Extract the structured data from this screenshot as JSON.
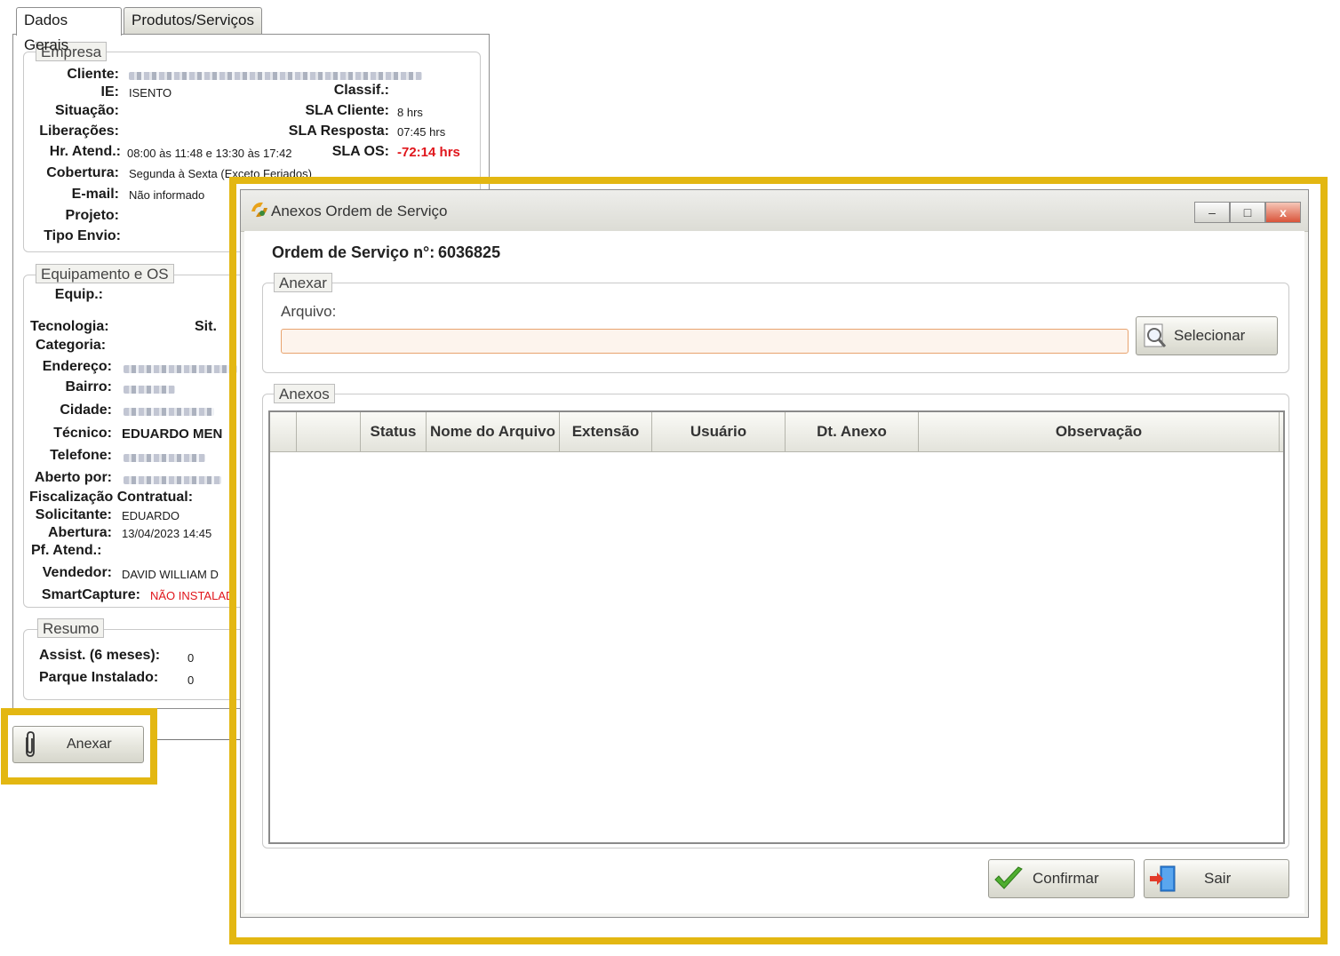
{
  "back_form": {
    "tabs": [
      "Dados Gerais",
      "Produtos/Serviços"
    ],
    "empresa": {
      "title": "Empresa",
      "cliente_label": "Cliente:",
      "ie_label": "IE:",
      "ie_value": "ISENTO",
      "classif_label": "Classif.:",
      "situacao_label": "Situação:",
      "sla_cliente_label": "SLA Cliente:",
      "sla_cliente_value": "8 hrs",
      "liberacoes_label": "Liberações:",
      "sla_resposta_label": "SLA Resposta:",
      "sla_resposta_value": "07:45 hrs",
      "hr_atend_label": "Hr. Atend.:",
      "hr_atend_value": "08:00 às 11:48 e 13:30 às 17:42",
      "sla_os_label": "SLA OS:",
      "sla_os_value": "-72:14 hrs",
      "cobertura_label": "Cobertura:",
      "cobertura_value": "Segunda à Sexta (Exceto Feriados)",
      "email_label": "E-mail:",
      "email_value": "Não informado",
      "projeto_label": "Projeto:",
      "tipo_envio_label": "Tipo Envio:"
    },
    "equipamento": {
      "title": "Equipamento e OS",
      "equip_label": "Equip.:",
      "tecnologia_label": "Tecnologia:",
      "sit_label": "Sit.",
      "categoria_label": "Categoria:",
      "endereco_label": "Endereço:",
      "bairro_label": "Bairro:",
      "cidade_label": "Cidade:",
      "tecnico_label": "Técnico:",
      "tecnico_value": "EDUARDO MEN",
      "telefone_label": "Telefone:",
      "aberto_por_label": "Aberto por:",
      "fiscalizacao_label": "Fiscalização Contratual:",
      "solicitante_label": "Solicitante:",
      "solicitante_value": "EDUARDO",
      "abertura_label": "Abertura:",
      "abertura_value": "13/04/2023 14:45",
      "pf_atend_label": "Pf. Atend.:",
      "vendedor_label": "Vendedor:",
      "vendedor_value": "DAVID WILLIAM D",
      "smartcapture_label": "SmartCapture:",
      "smartcapture_value": "NÃO INSTALAD"
    },
    "resumo": {
      "title": "Resumo",
      "assist_label": "Assist. (6 meses):",
      "assist_value": "0",
      "parque_label": "Parque Instalado:",
      "parque_value": "0"
    },
    "anexar_button": "Anexar"
  },
  "dialog": {
    "title": "Anexos Ordem de Serviço",
    "minimize": "–",
    "maximize": "□",
    "close": "x",
    "os_label": "Ordem de Serviço n°:",
    "os_number": "6036825",
    "anexar_group": "Anexar",
    "arquivo_label": "Arquivo:",
    "arquivo_value": "",
    "selecionar_button": "Selecionar",
    "anexos_group": "Anexos",
    "columns": [
      "",
      "",
      "Status",
      "Nome do Arquivo",
      "Extensão",
      "Usuário",
      "Dt. Anexo",
      "Observação"
    ],
    "confirmar_button": "Confirmar",
    "sair_button": "Sair"
  },
  "colors": {
    "highlight": "#e3b712",
    "sla_negative": "#e0151b",
    "input_border": "#e8a36e"
  }
}
